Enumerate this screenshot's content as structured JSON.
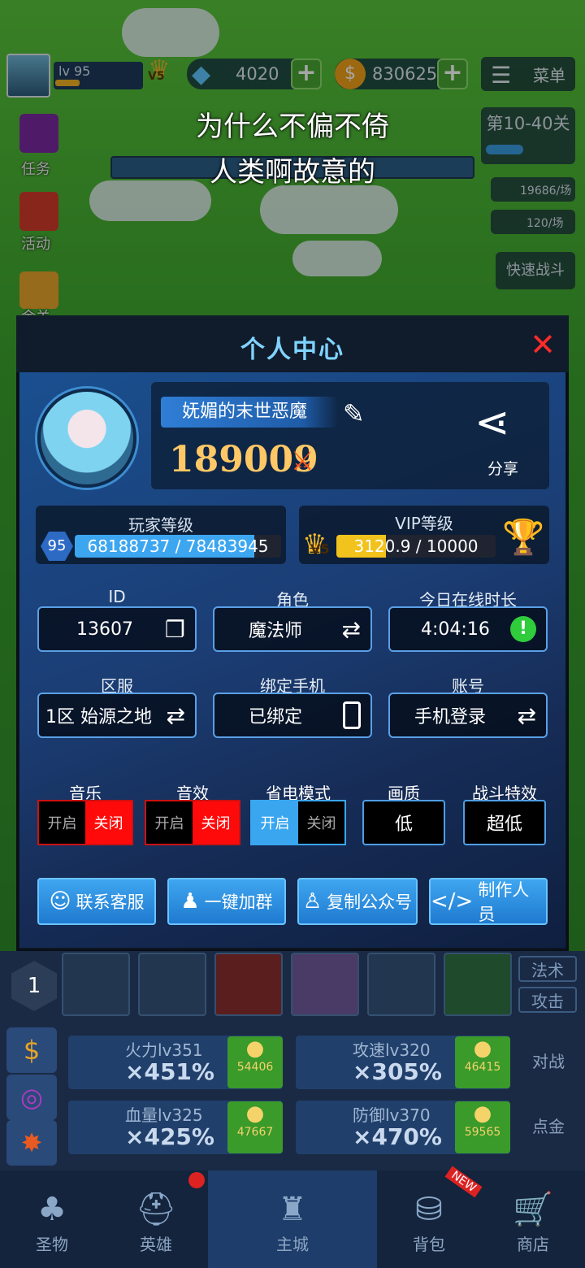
{
  "hud": {
    "level": "lv 95",
    "vip": "V5",
    "gems": "4020",
    "gold": "830625",
    "menu": "菜单",
    "left_items": [
      "任务",
      "活动",
      "金关"
    ],
    "stage": "第10-40关",
    "exp_rate": "19686/场",
    "gold_rate": "120/场",
    "quick_battle": "快速战斗"
  },
  "caption": {
    "line1": "为什么不偏不倚",
    "line2": "人类啊故意的"
  },
  "panel": {
    "title": "个人中心",
    "player_name": "妩媚的末世恶魔",
    "power": "189009",
    "share": "分享",
    "player_level_label": "玩家等级",
    "player_level": "95",
    "player_exp": "68188737 / 78483945",
    "player_exp_progress": 0.87,
    "vip_label": "VIP等级",
    "vip_badge": "V5",
    "vip_points": "3120.9 / 10000",
    "vip_progress": 0.31,
    "fields": {
      "id_label": "ID",
      "id_value": "13607",
      "role_label": "角色",
      "role_value": "魔法师",
      "online_label": "今日在线时长",
      "online_value": "4:04:16",
      "server_label": "区服",
      "server_value": "1区 始源之地",
      "phone_label": "绑定手机",
      "phone_value": "已绑定",
      "account_label": "账号",
      "account_value": "手机登录"
    },
    "settings": {
      "music_label": "音乐",
      "sfx_label": "音效",
      "power_save_label": "省电模式",
      "quality_label": "画质",
      "quality_value": "低",
      "battle_fx_label": "战斗特效",
      "battle_fx_value": "超低",
      "on": "开启",
      "off": "关闭"
    },
    "actions": {
      "contact": "联系客服",
      "join_group": "一键加群",
      "copy_official": "复制公众号",
      "credits": "制作人员"
    }
  },
  "lower": {
    "tabs": [
      "法术",
      "攻击"
    ],
    "upgrades": [
      {
        "name": "火力lv351",
        "value": "×451%",
        "cost": "54406"
      },
      {
        "name": "攻速lv320",
        "value": "×305%",
        "cost": "46415"
      },
      {
        "name": "血量lv325",
        "value": "×425%",
        "cost": "47667"
      },
      {
        "name": "防御lv370",
        "value": "×470%",
        "cost": "59565"
      }
    ],
    "side_right": [
      "对战",
      "点金"
    ],
    "skill_slot": "1"
  },
  "nav": [
    "圣物",
    "英雄",
    "主城",
    "背包",
    "商店"
  ],
  "nav_new_badge": "NEW",
  "colors": {
    "accent": "#3fa6f0",
    "close": "#ff2a2a",
    "toggle_off_active": "#ff0a0a",
    "toggle_on_active": "#3aa6ef"
  }
}
